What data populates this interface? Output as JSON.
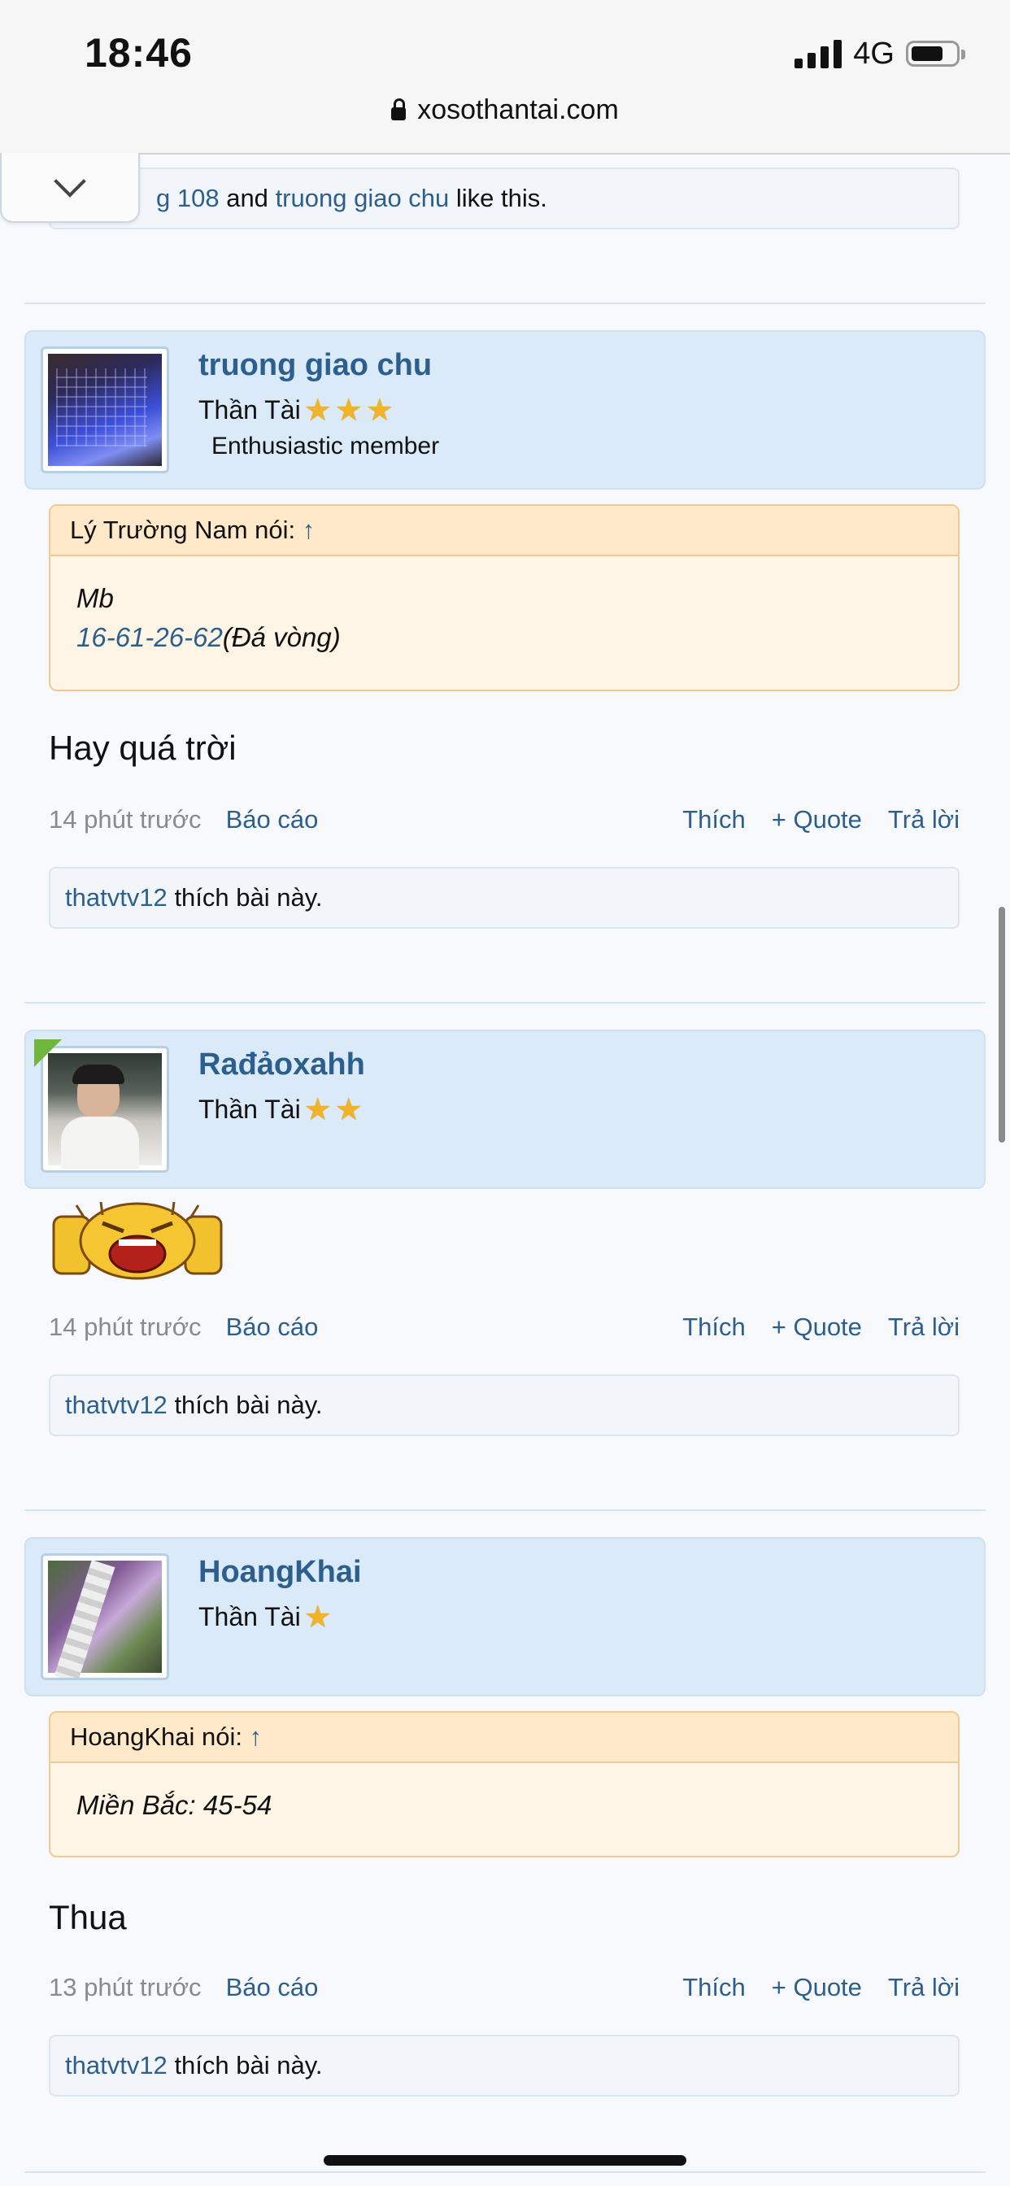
{
  "status": {
    "time": "18:46",
    "network": "4G"
  },
  "browser": {
    "url": "xosothantai.com"
  },
  "top_like": {
    "user1": "g 108",
    "and": "and",
    "user2": "truong giao chu",
    "suffix": "like this."
  },
  "posts": [
    {
      "username": "truong giao chu",
      "rank": "Thần Tài",
      "stars": 3,
      "member_title": "Enthusiastic member",
      "quote": {
        "header": "Lý Trường Nam nói:",
        "arrow": "↑",
        "line1": "Mb",
        "link": "16-61-26-62",
        "suffix": "(Đá vòng)"
      },
      "message": "Hay quá trời",
      "time": "14 phút trước",
      "report": "Báo cáo",
      "like": "Thích",
      "quote_btn": "+ Quote",
      "reply": "Trả lời",
      "liker": "thatvtv12",
      "liker_suffix": "thích bài này."
    },
    {
      "username": "Rađảoxahh",
      "rank": "Thần Tài",
      "stars": 2,
      "time": "14 phút trước",
      "report": "Báo cáo",
      "like": "Thích",
      "quote_btn": "+ Quote",
      "reply": "Trả lời",
      "liker": "thatvtv12",
      "liker_suffix": "thích bài này."
    },
    {
      "username": "HoangKhai",
      "rank": "Thần Tài",
      "stars": 1,
      "quote": {
        "header": "HoangKhai nói:",
        "arrow": "↑",
        "line1": "Miền Bắc: 45-54"
      },
      "message": "Thua",
      "time": "13 phút trước",
      "report": "Báo cáo",
      "like": "Thích",
      "quote_btn": "+ Quote",
      "reply": "Trả lời",
      "liker": "thatvtv12",
      "liker_suffix": "thích bài này."
    }
  ],
  "colors": {
    "link": "#2c5f8e",
    "userbox": "#dbeaf8",
    "quote_bg": "#fff5e6",
    "quote_border": "#f0c995",
    "star": "#f0b32a"
  }
}
